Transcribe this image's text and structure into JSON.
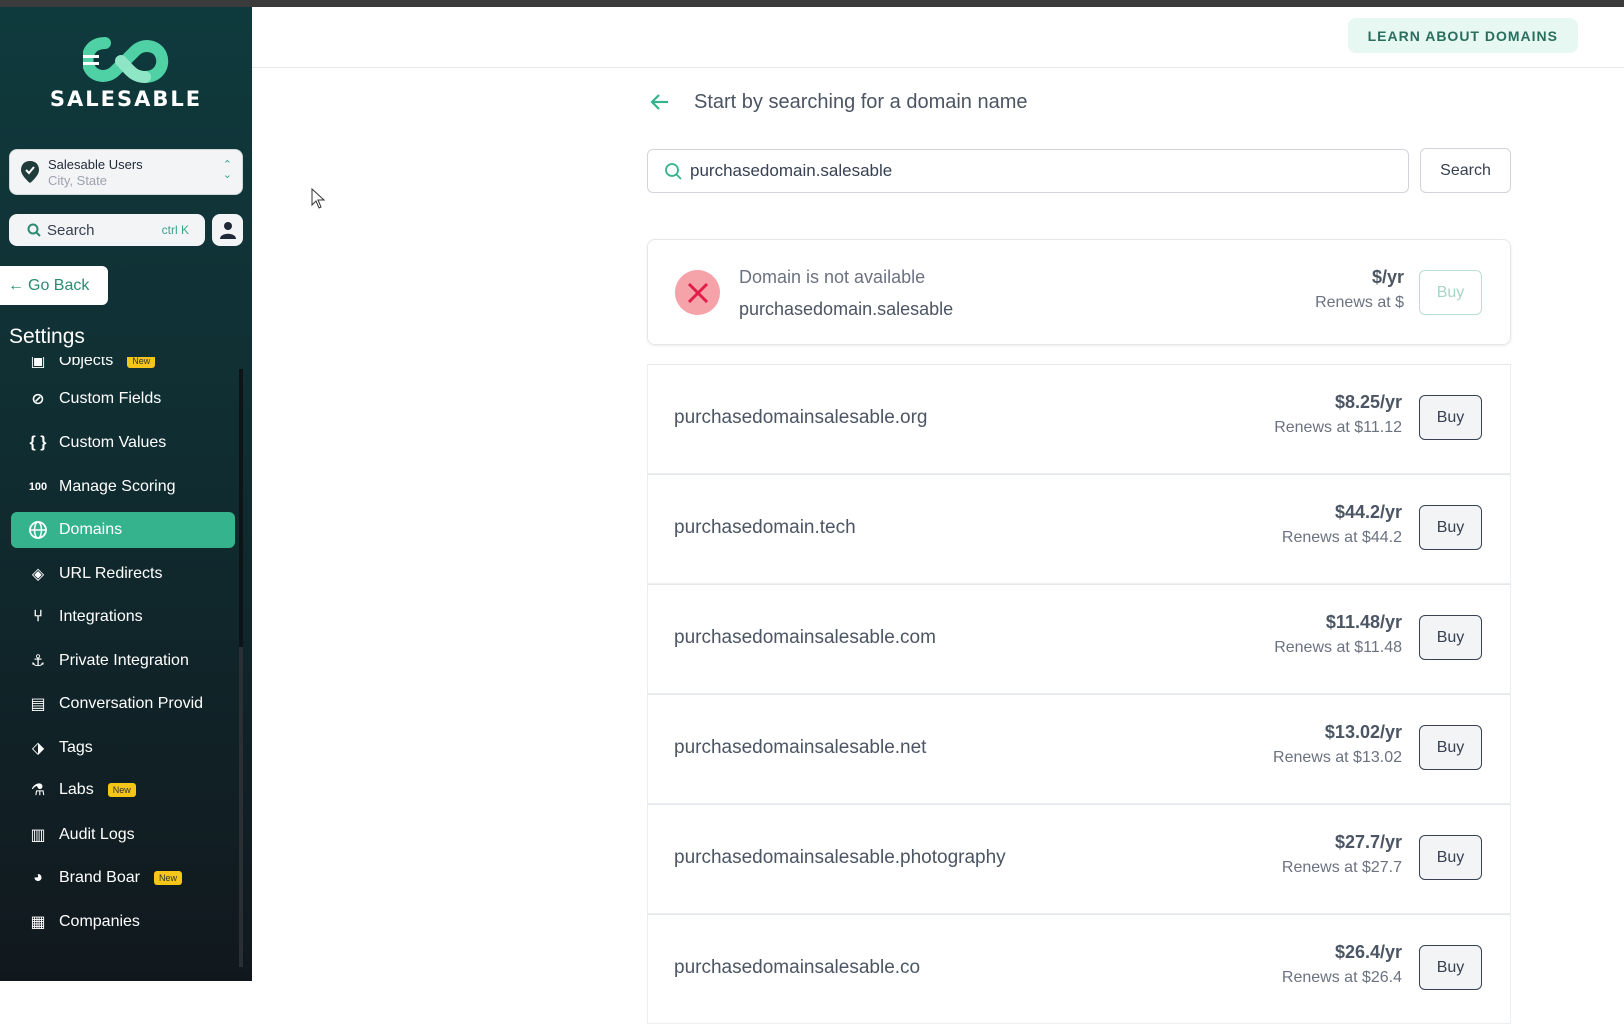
{
  "sidebar": {
    "logo_text": "SALESABLE",
    "account": {
      "name": "Salesable Users",
      "location": "City, State"
    },
    "search": {
      "label": "Search",
      "shortcut": "ctrl K"
    },
    "go_back": "Go Back",
    "settings_title": "Settings",
    "items": [
      {
        "label": "Objects",
        "icon": "cube-icon",
        "badge": "New",
        "active": false
      },
      {
        "label": "Custom Fields",
        "icon": "fields-icon",
        "badge": "",
        "active": false
      },
      {
        "label": "Custom Values",
        "icon": "braces-icon",
        "badge": "",
        "active": false
      },
      {
        "label": "Manage Scoring",
        "icon": "score-icon",
        "badge": "",
        "active": false
      },
      {
        "label": "Domains",
        "icon": "globe-icon",
        "badge": "",
        "active": true
      },
      {
        "label": "URL Redirects",
        "icon": "redirect-icon",
        "badge": "",
        "active": false
      },
      {
        "label": "Integrations",
        "icon": "branch-icon",
        "badge": "",
        "active": false
      },
      {
        "label": "Private Integration",
        "icon": "private-integration-icon",
        "badge": "",
        "active": false
      },
      {
        "label": "Conversation Provid",
        "icon": "clipboard-icon",
        "badge": "",
        "active": false
      },
      {
        "label": "Tags",
        "icon": "tag-icon",
        "badge": "",
        "active": false
      },
      {
        "label": "Labs",
        "icon": "flask-icon",
        "badge": "New",
        "active": false
      },
      {
        "label": "Audit Logs",
        "icon": "audit-icon",
        "badge": "",
        "active": false
      },
      {
        "label": "Brand Boar",
        "icon": "palette-icon",
        "badge": "New",
        "active": false
      },
      {
        "label": "Companies",
        "icon": "building-icon",
        "badge": "",
        "active": false
      }
    ]
  },
  "header": {
    "learn_button": "LEARN ABOUT DOMAINS"
  },
  "main": {
    "title": "Start by searching for a domain name",
    "search_value": "purchasedomain.salesable",
    "search_button": "Search",
    "unavailable": {
      "message": "Domain is not available",
      "domain": "purchasedomain.salesable",
      "price": "$/yr",
      "renew": "Renews at $",
      "buy_label": "Buy"
    },
    "results": [
      {
        "domain": "purchasedomainsalesable.org",
        "price": "$8.25/yr",
        "renew": "Renews at $11.12",
        "buy_label": "Buy"
      },
      {
        "domain": "purchasedomain.tech",
        "price": "$44.2/yr",
        "renew": "Renews at $44.2",
        "buy_label": "Buy"
      },
      {
        "domain": "purchasedomainsalesable.com",
        "price": "$11.48/yr",
        "renew": "Renews at $11.48",
        "buy_label": "Buy"
      },
      {
        "domain": "purchasedomainsalesable.net",
        "price": "$13.02/yr",
        "renew": "Renews at $13.02",
        "buy_label": "Buy"
      },
      {
        "domain": "purchasedomainsalesable.photography",
        "price": "$27.7/yr",
        "renew": "Renews at $27.7",
        "buy_label": "Buy"
      },
      {
        "domain": "purchasedomainsalesable.co",
        "price": "$26.4/yr",
        "renew": "Renews at $26.4",
        "buy_label": "Buy"
      }
    ]
  },
  "colors": {
    "accent": "#34b38d",
    "sidebar_bg": "#0f3a3d",
    "error": "#e11d48"
  }
}
